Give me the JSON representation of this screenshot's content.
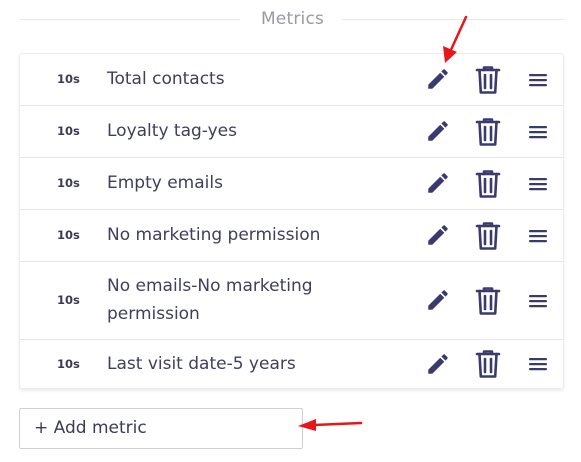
{
  "section": {
    "title": "Metrics"
  },
  "metrics": [
    {
      "duration": "10s",
      "label": "Total contacts"
    },
    {
      "duration": "10s",
      "label": "Loyalty tag-yes"
    },
    {
      "duration": "10s",
      "label": "Empty emails"
    },
    {
      "duration": "10s",
      "label": "No marketing permission"
    },
    {
      "duration": "10s",
      "label": "No emails-No marketing permission"
    },
    {
      "duration": "10s",
      "label": "Last visit date-5 years"
    }
  ],
  "row_icons": [
    "pencil-icon",
    "trash-icon",
    "drag-handle-icon"
  ],
  "add_button": {
    "label": "+ Add metric"
  },
  "colors": {
    "icon": "#3b3a6e",
    "annotation": "#e8161b",
    "text": "#3a3b56"
  }
}
